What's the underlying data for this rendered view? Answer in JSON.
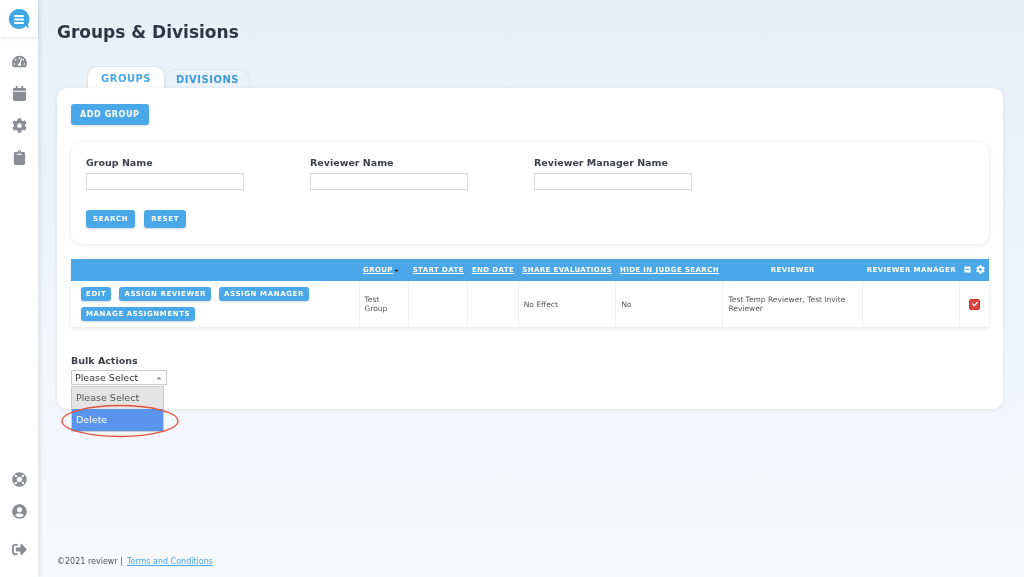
{
  "title": "Groups & Divisions",
  "tabs": [
    {
      "label": "GROUPS",
      "selected": true
    },
    {
      "label": "DIVISIONS",
      "selected": false
    }
  ],
  "add_button": "ADD GROUP",
  "filters": [
    {
      "label": "Group Name"
    },
    {
      "label": "Reviewer Name"
    },
    {
      "label": "Reviewer Manager Name"
    }
  ],
  "filter_buttons": [
    "SEARCH",
    "RESET"
  ],
  "table": {
    "columns": [
      {
        "kind": "actions"
      },
      {
        "label": "GROUP",
        "link": true,
        "sorted": true
      },
      {
        "label": "START DATE",
        "link": true
      },
      {
        "label": "END DATE",
        "link": true
      },
      {
        "label": "SHARE EVALUATIONS",
        "link": true
      },
      {
        "label": "HIDE IN JUDGE SEARCH",
        "link": true
      },
      {
        "label": "REVIEWER",
        "link": false
      },
      {
        "label": "REVIEWER MANAGER",
        "link": false
      },
      {
        "kind": "tools"
      }
    ],
    "rows": [
      {
        "actions": [
          "EDIT",
          "ASSIGN REVIEWER",
          "ASSIGN MANAGER",
          "MANAGE ASSIGNMENTS"
        ],
        "cells": [
          "",
          "Test Group",
          "",
          "",
          "No Effect",
          "No",
          "Test Temp Reviewer, Test Invite Reviewer",
          ""
        ],
        "checked": true
      }
    ]
  },
  "bulk": {
    "label": "Bulk Actions",
    "value": "Please Select",
    "expanded": true,
    "options": [
      {
        "label": "Please Select",
        "selected": true,
        "highlighted": false,
        "circled": false
      },
      {
        "label": "Delete",
        "selected": false,
        "highlighted": true,
        "circled": true
      }
    ]
  },
  "footer": {
    "copyright": "©2021 reviewr |",
    "link": "Terms and Conditions"
  }
}
